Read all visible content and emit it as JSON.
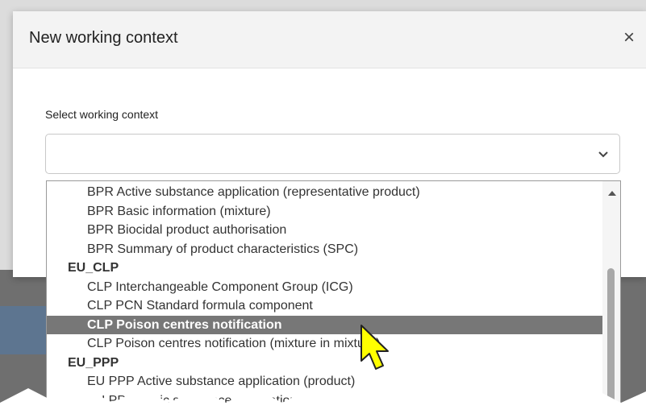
{
  "dialog": {
    "title": "New working context",
    "close_glyph": "×"
  },
  "field": {
    "label": "Select working context",
    "value": ""
  },
  "dropdown": {
    "rows": [
      {
        "kind": "option",
        "label": "BPR Active substance application (representative product)"
      },
      {
        "kind": "option",
        "label": "BPR Basic information (mixture)"
      },
      {
        "kind": "option",
        "label": "BPR Biocidal product authorisation"
      },
      {
        "kind": "option",
        "label": "BPR Summary of product characteristics (SPC)"
      },
      {
        "kind": "group",
        "label": "EU_CLP"
      },
      {
        "kind": "option",
        "label": "CLP Interchangeable Component Group (ICG)"
      },
      {
        "kind": "option",
        "label": "CLP PCN Standard formula component"
      },
      {
        "kind": "option",
        "label": "CLP Poison centres notification",
        "selected": true
      },
      {
        "kind": "option",
        "label": "CLP Poison centres notification (mixture in mixture)"
      },
      {
        "kind": "group",
        "label": "EU_PPP"
      },
      {
        "kind": "option",
        "label": "EU PPP Active substance application (product)"
      },
      {
        "kind": "option",
        "label": "EU PPP Basic substance application"
      }
    ]
  },
  "colors": {
    "selected_row": "#777777",
    "cursor": "#ffff00"
  },
  "icons": [
    "close-icon",
    "chevron-down-icon",
    "scroll-up-arrow-icon",
    "mouse-cursor-icon"
  ]
}
